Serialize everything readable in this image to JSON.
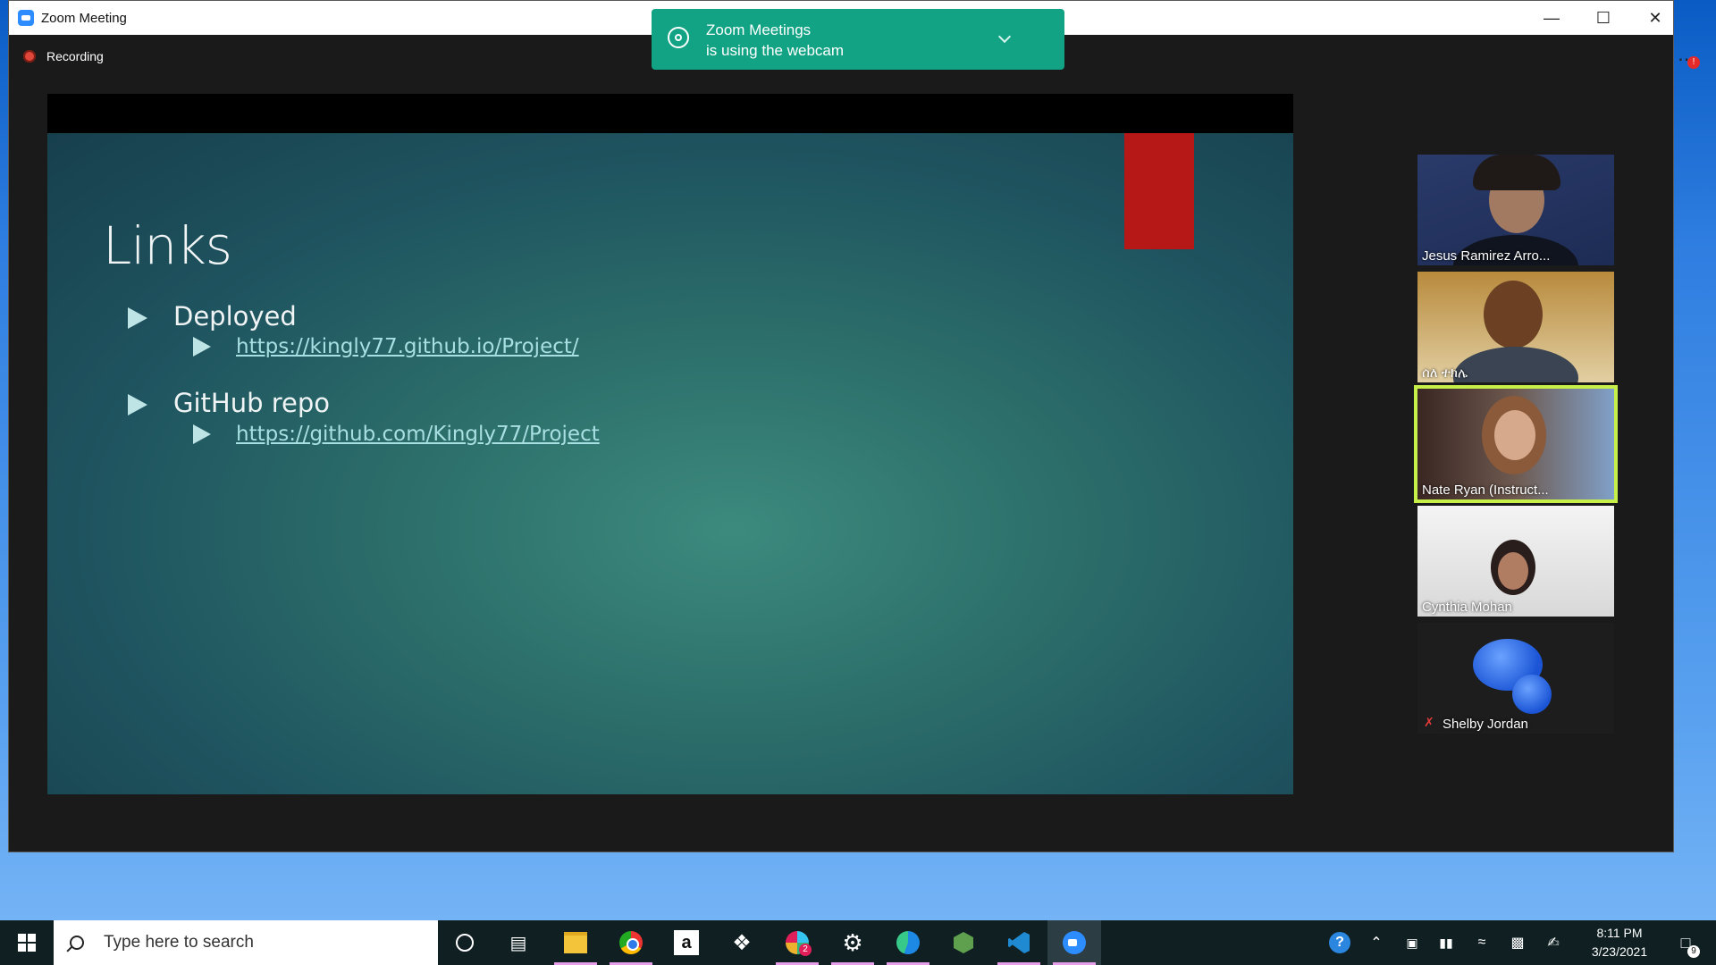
{
  "window": {
    "title": "Zoom Meeting"
  },
  "recording": {
    "label": "Recording"
  },
  "toast": {
    "line1": "Zoom Meetings",
    "line2": "is using the webcam"
  },
  "slide": {
    "title": "Links",
    "items": [
      {
        "label": "Deployed",
        "link": "https://kingly77.github.io/Project/"
      },
      {
        "label": "GitHub repo",
        "link": "https://github.com/Kingly77/Project"
      }
    ]
  },
  "participants": [
    {
      "name": "Jesus Ramirez Arro...",
      "active": false
    },
    {
      "name": "ሰለ ተክሌ",
      "active": false
    },
    {
      "name": "Nate Ryan (Instruct...",
      "active": true
    },
    {
      "name": "Cynthia Mohan",
      "active": false
    },
    {
      "name": "Shelby Jordan",
      "active": false,
      "muted": true
    }
  ],
  "taskbar": {
    "search_placeholder": "Type here to search",
    "time": "8:11 PM",
    "date": "3/23/2021",
    "notification_count": "9",
    "slack_badge": "2",
    "icons": [
      "start-icon",
      "cortana-icon",
      "task-view-icon",
      "file-explorer-icon",
      "chrome-icon",
      "amazon-icon",
      "dropbox-icon",
      "slack-icon",
      "settings-icon",
      "edge-icon",
      "nodejs-icon",
      "vscode-icon",
      "zoom-icon"
    ]
  },
  "colors": {
    "toast": "#11a384",
    "active_speaker": "#c7ef4a",
    "slide_red": "#b61818"
  }
}
